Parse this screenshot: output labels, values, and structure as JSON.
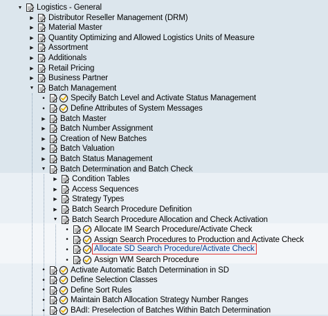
{
  "colors": {
    "background": "#dce6ed",
    "band_light": "#eaf0f5",
    "band_lighter": "#f3f6f9",
    "selection_outline": "#e03030",
    "check_icon": "#e8b400"
  },
  "tree": {
    "rows": [
      {
        "label": "Logistics - General",
        "depth": 0,
        "toggle": "expanded",
        "icons": [
          "document-icon"
        ]
      },
      {
        "label": "Distributor Reseller Management (DRM)",
        "depth": 1,
        "toggle": "collapsed",
        "icons": [
          "document-icon"
        ]
      },
      {
        "label": "Material Master",
        "depth": 1,
        "toggle": "collapsed",
        "icons": [
          "document-icon"
        ]
      },
      {
        "label": "Quantity Optimizing and Allowed Logistics Units of Measure",
        "depth": 1,
        "toggle": "collapsed",
        "icons": [
          "document-icon"
        ]
      },
      {
        "label": "Assortment",
        "depth": 1,
        "toggle": "collapsed",
        "icons": [
          "document-icon"
        ]
      },
      {
        "label": "Additionals",
        "depth": 1,
        "toggle": "collapsed",
        "icons": [
          "document-icon"
        ]
      },
      {
        "label": "Retail Pricing",
        "depth": 1,
        "toggle": "collapsed",
        "icons": [
          "document-icon"
        ]
      },
      {
        "label": "Business Partner",
        "depth": 1,
        "toggle": "collapsed",
        "icons": [
          "document-icon"
        ]
      },
      {
        "label": "Batch Management",
        "depth": 1,
        "toggle": "expanded",
        "icons": [
          "document-icon"
        ]
      },
      {
        "label": "Specify Batch Level and Activate Status Management",
        "depth": 2,
        "toggle": "leaf",
        "icons": [
          "document-icon",
          "execute-check-icon"
        ]
      },
      {
        "label": "Define Attributes of System Messages",
        "depth": 2,
        "toggle": "leaf",
        "icons": [
          "document-icon",
          "execute-check-icon"
        ]
      },
      {
        "label": "Batch Master",
        "depth": 2,
        "toggle": "collapsed",
        "icons": [
          "document-icon"
        ]
      },
      {
        "label": "Batch Number Assignment",
        "depth": 2,
        "toggle": "collapsed",
        "icons": [
          "document-icon"
        ]
      },
      {
        "label": "Creation of New Batches",
        "depth": 2,
        "toggle": "collapsed",
        "icons": [
          "document-icon"
        ]
      },
      {
        "label": "Batch Valuation",
        "depth": 2,
        "toggle": "collapsed",
        "icons": [
          "document-icon"
        ]
      },
      {
        "label": "Batch Status Management",
        "depth": 2,
        "toggle": "collapsed",
        "icons": [
          "document-icon"
        ]
      },
      {
        "label": "Batch Determination and Batch Check",
        "depth": 2,
        "toggle": "expanded",
        "icons": [
          "document-icon"
        ]
      },
      {
        "label": "Condition Tables",
        "depth": 3,
        "toggle": "collapsed",
        "icons": [
          "document-icon"
        ]
      },
      {
        "label": "Access Sequences",
        "depth": 3,
        "toggle": "collapsed",
        "icons": [
          "document-icon"
        ]
      },
      {
        "label": "Strategy Types",
        "depth": 3,
        "toggle": "collapsed",
        "icons": [
          "document-icon"
        ]
      },
      {
        "label": "Batch Search Procedure Definition",
        "depth": 3,
        "toggle": "collapsed",
        "icons": [
          "document-icon"
        ]
      },
      {
        "label": "Batch Search Procedure Allocation and Check Activation",
        "depth": 3,
        "toggle": "expanded",
        "icons": [
          "document-icon"
        ]
      },
      {
        "label": "Allocate IM Search Procedure/Activate Check",
        "depth": 4,
        "toggle": "leaf",
        "icons": [
          "document-icon",
          "execute-check-icon"
        ]
      },
      {
        "label": "Assign Search Procedures to Production and Activate Check",
        "depth": 4,
        "toggle": "leaf",
        "icons": [
          "document-icon",
          "execute-check-icon"
        ]
      },
      {
        "label": "Allocate SD Search Procedure/Activate Check",
        "depth": 4,
        "toggle": "leaf",
        "icons": [
          "document-icon",
          "execute-check-icon"
        ],
        "selected": true
      },
      {
        "label": "Assign WM Search Procedure",
        "depth": 4,
        "toggle": "leaf",
        "icons": [
          "document-icon",
          "execute-check-icon"
        ]
      },
      {
        "label": "Activate Automatic Batch Determination in SD",
        "depth": 2,
        "toggle": "leaf",
        "icons": [
          "document-icon",
          "execute-check-icon"
        ]
      },
      {
        "label": "Define Selection Classes",
        "depth": 2,
        "toggle": "leaf",
        "icons": [
          "document-icon",
          "execute-check-icon"
        ]
      },
      {
        "label": "Define Sort Rules",
        "depth": 2,
        "toggle": "leaf",
        "icons": [
          "document-icon",
          "execute-check-icon"
        ]
      },
      {
        "label": "Maintain Batch Allocation Strategy Number Ranges",
        "depth": 2,
        "toggle": "leaf",
        "icons": [
          "document-icon",
          "execute-check-icon"
        ]
      },
      {
        "label": "BAdI: Preselection of Batches Within Batch Determination",
        "depth": 2,
        "toggle": "leaf",
        "icons": [
          "document-icon",
          "execute-check-icon"
        ]
      }
    ]
  }
}
